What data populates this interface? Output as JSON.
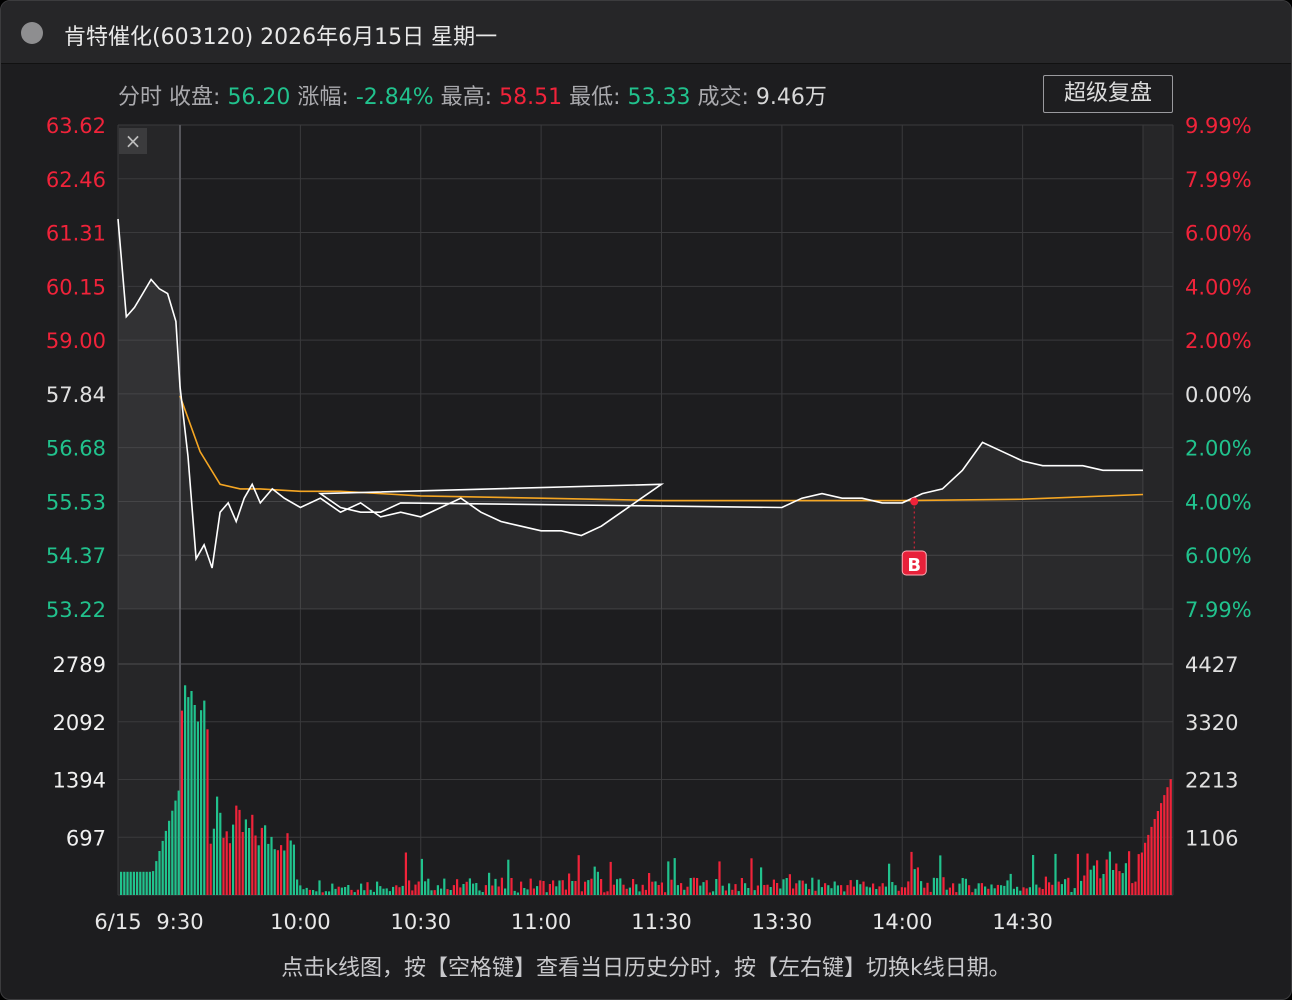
{
  "window": {
    "title": "肯特催化(603120) 2026年6月15日 星期一"
  },
  "info": {
    "mode": "分时",
    "close_label": "收盘:",
    "close_value": "56.20",
    "change_label": "涨幅:",
    "change_value": "-2.84%",
    "high_label": "最高:",
    "high_value": "58.51",
    "low_label": "最低:",
    "low_value": "53.33",
    "volume_label": "成交:",
    "volume_value": "9.46万",
    "replay_button": "超级复盘",
    "close_icon": "×"
  },
  "hint": "点击k线图，按【空格键】查看当日历史分时，按【左右键】切换k线日期。",
  "colors": {
    "up": "#f0233a",
    "down": "#21c28d",
    "price_line": "#ffffff",
    "avg_line": "#f5a623",
    "grid": "#3a3a3c"
  },
  "chart_data": {
    "type": "line",
    "date_label": "6/15",
    "x_ticks": [
      "9:30",
      "10:00",
      "10:30",
      "11:00",
      "11:30",
      "13:30",
      "14:00",
      "14:30"
    ],
    "price_axis": {
      "ylim": [
        53.22,
        63.62
      ],
      "left_ticks": [
        "63.62",
        "62.46",
        "61.31",
        "60.15",
        "59.00",
        "57.84",
        "56.68",
        "55.53",
        "54.37",
        "53.22"
      ],
      "right_ticks": [
        "9.99%",
        "7.99%",
        "6.00%",
        "4.00%",
        "2.00%",
        "0.00%",
        "2.00%",
        "4.00%",
        "6.00%",
        "7.99%"
      ],
      "reference": 57.84
    },
    "volume_axis": {
      "left_ticks": [
        "2789",
        "2092",
        "1394",
        "697"
      ],
      "right_ticks": [
        "4427",
        "3320",
        "2213",
        "1106"
      ],
      "ylim": [
        0,
        2789
      ]
    },
    "marker": {
      "label": "B",
      "time": "14:00",
      "price": 55.53
    },
    "series": [
      {
        "key": "price",
        "x": [
          "9:15",
          "9:17",
          "9:19",
          "9:21",
          "9:23",
          "9:25",
          "9:27",
          "9:29",
          "9:30",
          "9:32",
          "9:34",
          "9:36",
          "9:38",
          "9:40",
          "9:42",
          "9:44",
          "9:46",
          "9:48",
          "9:50",
          "9:53",
          "9:56",
          "10:00",
          "10:05",
          "10:10",
          "10:15",
          "10:20",
          "10:25",
          "10:30",
          "10:35",
          "10:40",
          "10:45",
          "10:50",
          "10:55",
          "11:00",
          "11:05",
          "11:10",
          "11:15",
          "11:20",
          "11:25",
          "11:30",
          "11:35",
          "11:40",
          "11:45",
          "11:50",
          "11:55",
          "13:30",
          "13:35",
          "13:40",
          "13:45",
          "13:50",
          "13:55",
          "14:00",
          "14:05",
          "14:10",
          "14:15",
          "14:20",
          "14:25",
          "14:30",
          "14:35",
          "14:40",
          "14:45",
          "14:50",
          "14:55",
          "15:00"
        ],
        "values": [
          61.6,
          59.5,
          59.7,
          60.0,
          60.3,
          60.1,
          60.0,
          59.4,
          58.0,
          56.5,
          54.3,
          54.6,
          54.1,
          55.3,
          55.5,
          55.1,
          55.6,
          55.9,
          55.5,
          55.8,
          55.6,
          55.4,
          55.6,
          55.3,
          55.5,
          55.2,
          55.3,
          55.2,
          55.4,
          55.6,
          55.3,
          55.1,
          55.0,
          54.9,
          54.9,
          54.8,
          55.0,
          55.3,
          55.6,
          55.9,
          55.7,
          55.4,
          55.3,
          55.3,
          55.5,
          55.4,
          55.6,
          55.7,
          55.6,
          55.6,
          55.5,
          55.5,
          55.7,
          55.8,
          56.2,
          56.8,
          56.6,
          56.4,
          56.3,
          56.3,
          56.3,
          56.2,
          56.2,
          56.2
        ]
      },
      {
        "key": "average",
        "x": [
          "9:30",
          "9:35",
          "9:40",
          "9:45",
          "9:50",
          "10:00",
          "10:10",
          "10:20",
          "10:30",
          "11:00",
          "11:30",
          "13:30",
          "14:00",
          "14:30",
          "15:00"
        ],
        "values": [
          57.8,
          56.6,
          55.9,
          55.8,
          55.8,
          55.75,
          55.75,
          55.7,
          55.65,
          55.6,
          55.55,
          55.55,
          55.55,
          55.58,
          55.68
        ]
      }
    ]
  }
}
